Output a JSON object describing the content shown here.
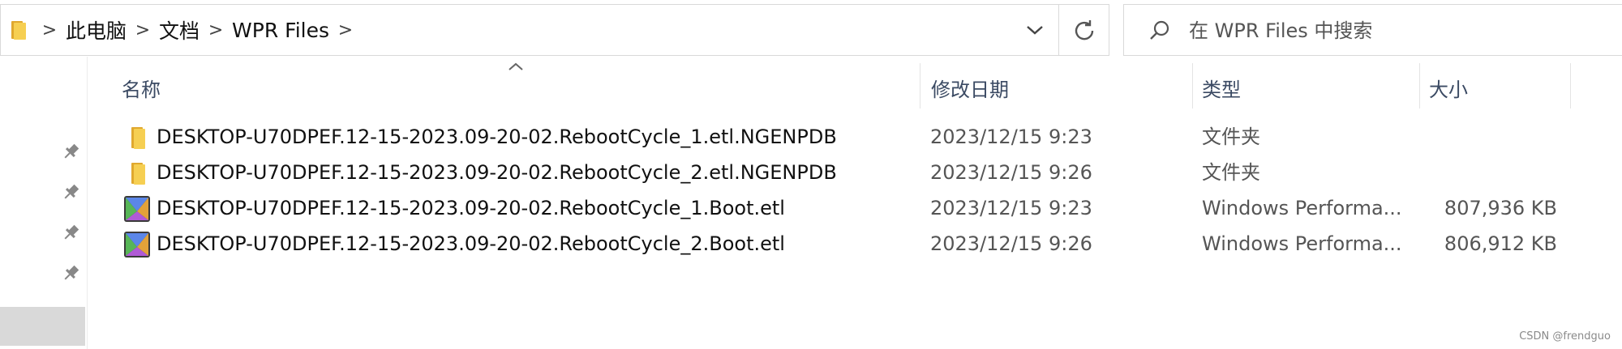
{
  "address_bar": {
    "breadcrumbs": [
      "此电脑",
      "文档",
      "WPR Files"
    ],
    "separator": ">"
  },
  "search": {
    "placeholder": "在 WPR Files 中搜索"
  },
  "columns": {
    "name": "名称",
    "date": "修改日期",
    "type": "类型",
    "size": "大小"
  },
  "files": [
    {
      "name": "DESKTOP-U70DPEF.12-15-2023.09-20-02.RebootCycle_1.etl.NGENPDB",
      "date": "2023/12/15 9:23",
      "type": "文件夹",
      "size": "",
      "icon": "folder-icon"
    },
    {
      "name": "DESKTOP-U70DPEF.12-15-2023.09-20-02.RebootCycle_2.etl.NGENPDB",
      "date": "2023/12/15 9:26",
      "type": "文件夹",
      "size": "",
      "icon": "folder-icon"
    },
    {
      "name": "DESKTOP-U70DPEF.12-15-2023.09-20-02.RebootCycle_1.Boot.etl",
      "date": "2023/12/15 9:23",
      "type": "Windows Performa...",
      "size": "807,936 KB",
      "icon": "etl-file-icon"
    },
    {
      "name": "DESKTOP-U70DPEF.12-15-2023.09-20-02.RebootCycle_2.Boot.etl",
      "date": "2023/12/15 9:26",
      "type": "Windows Performa...",
      "size": "806,912 KB",
      "icon": "etl-file-icon"
    }
  ],
  "watermark": "CSDN @frendguo",
  "colors": {
    "folder": "#f2c744",
    "header_text": "#3b4a63",
    "border": "#d9d9d9"
  }
}
